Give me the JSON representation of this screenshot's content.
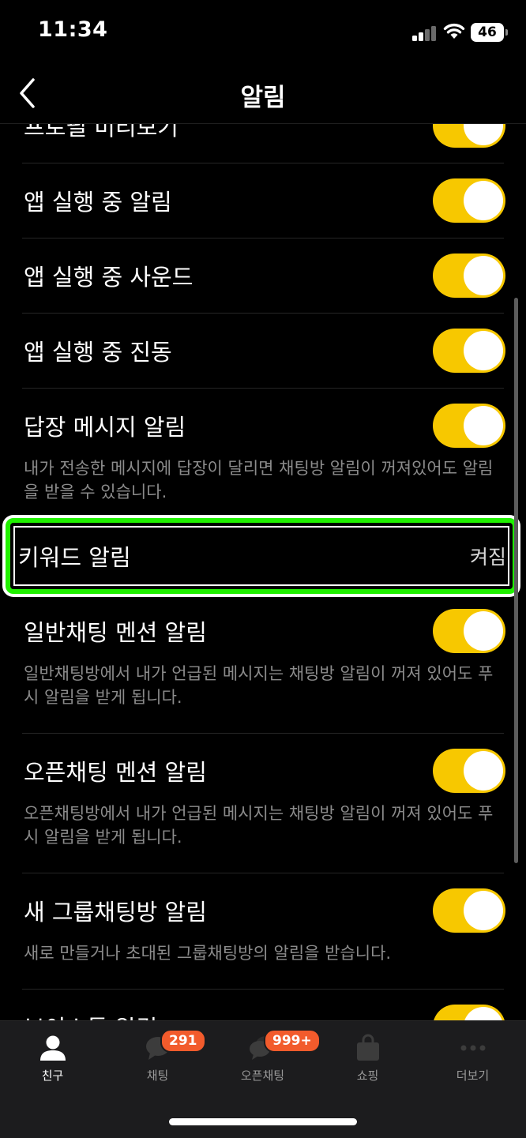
{
  "status_bar": {
    "time": "11:34",
    "battery": "46"
  },
  "nav": {
    "title": "알림"
  },
  "settings": [
    {
      "label": "프로필 미리보기",
      "on": true
    },
    {
      "label": "앱 실행 중 알림",
      "on": true
    },
    {
      "label": "앱 실행 중 사운드",
      "on": true
    },
    {
      "label": "앱 실행 중 진동",
      "on": true
    },
    {
      "label": "답장 메시지 알림",
      "on": true,
      "description": "내가 전송한 메시지에 답장이 달리면 채팅방 알림이 꺼져있어도 알림을 받을 수 있습니다."
    },
    {
      "label": "키워드 알림",
      "value": "켜짐"
    },
    {
      "label": "일반채팅 멘션 알림",
      "on": true,
      "description": "일반채팅방에서 내가 언급된 메시지는 채팅방 알림이 꺼져 있어도 푸시 알림을 받게 됩니다."
    },
    {
      "label": "오픈채팅 멘션 알림",
      "on": true,
      "description": "오픈채팅방에서 내가 언급된 메시지는 채팅방 알림이 꺼져 있어도 푸시 알림을 받게 됩니다."
    },
    {
      "label": "새 그룹채팅방 알림",
      "on": true,
      "description": "새로 만들거나 초대된 그룹채팅방의 알림을 받습니다."
    },
    {
      "label": "보이스톡 알림",
      "on": true
    }
  ],
  "tabs": [
    {
      "label": "친구",
      "icon": "friends-icon",
      "active": true
    },
    {
      "label": "채팅",
      "icon": "chat-icon",
      "badge": "291"
    },
    {
      "label": "오픈채팅",
      "icon": "open-chat-icon",
      "badge": "999+"
    },
    {
      "label": "쇼핑",
      "icon": "shopping-bag-icon"
    },
    {
      "label": "더보기",
      "icon": "more-icon"
    }
  ],
  "colors": {
    "toggle_on": "#f7c800",
    "badge": "#f25b2c",
    "highlight": "#20f000"
  }
}
